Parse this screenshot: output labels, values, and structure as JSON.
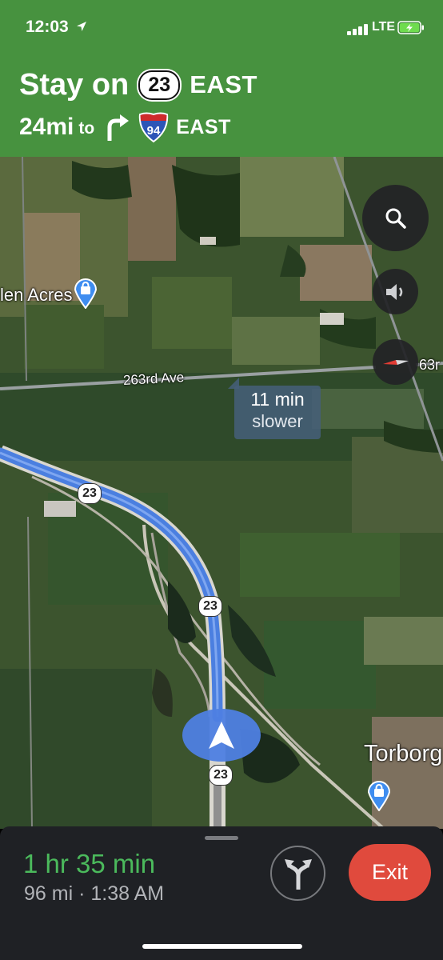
{
  "status_bar": {
    "time": "12:03",
    "network": "LTE",
    "location_icon": "location-arrow-icon",
    "battery_icon": "battery-charging-icon"
  },
  "instruction": {
    "action": "Stay on",
    "route_shield": "23",
    "direction": "EAST",
    "distance": "24mi",
    "to_word": "to",
    "next_maneuver_icon": "turn-right-icon",
    "next_route_shield": "94",
    "next_direction": "EAST",
    "colors": {
      "banner": "#47923f"
    }
  },
  "map": {
    "places": [
      {
        "label": "len Acres"
      },
      {
        "label": "Torborg"
      }
    ],
    "roads": [
      {
        "label": "263rd Ave"
      },
      {
        "label": "63r"
      }
    ],
    "route_shields": [
      "23",
      "23",
      "23"
    ],
    "traffic_callout": {
      "time": "11 min",
      "status": "slower"
    },
    "buttons": {
      "search": "search-icon",
      "audio": "speaker-icon",
      "compass": "compass-icon"
    },
    "colors": {
      "route": "#4b7fe0",
      "position_puck": "#4e80e2"
    }
  },
  "trip": {
    "eta_duration": "1 hr 35 min",
    "distance": "96 mi",
    "separator": "·",
    "arrival_time": "1:38 AM",
    "route_options_icon": "fork-arrows-icon",
    "exit_label": "Exit",
    "colors": {
      "eta": "#4bba5c",
      "exit": "#e04a3d"
    }
  }
}
